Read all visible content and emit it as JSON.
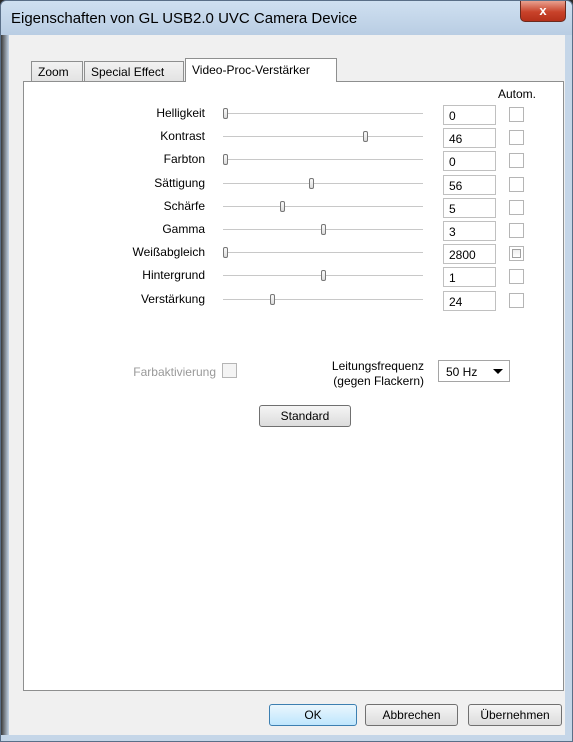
{
  "window": {
    "title": "Eigenschaften von GL USB2.0 UVC Camera Device",
    "close_label": "x"
  },
  "tabs": [
    {
      "label": "Zoom",
      "active": false
    },
    {
      "label": "Special Effect",
      "active": false
    },
    {
      "label": "Video-Proc-Verstärker",
      "active": true
    }
  ],
  "autom_header": "Autom.",
  "sliders": [
    {
      "label": "Helligkeit",
      "value": "0",
      "level": 0.0
    },
    {
      "label": "Kontrast",
      "value": "46",
      "level": 0.72
    },
    {
      "label": "Farbton",
      "value": "0",
      "level": 0.0
    },
    {
      "label": "Sättigung",
      "value": "56",
      "level": 0.44
    },
    {
      "label": "Schärfe",
      "value": "5",
      "level": 0.29
    },
    {
      "label": "Gamma",
      "value": "3",
      "level": 0.5
    },
    {
      "label": "Weißabgleich",
      "value": "2800",
      "level": 0.0
    },
    {
      "label": "Hintergrund",
      "value": "1",
      "level": 0.5
    },
    {
      "label": "Verstärkung",
      "value": "24",
      "level": 0.24
    }
  ],
  "farbaktivierung_label": "Farbaktivierung",
  "leitungsfrequenz_label_1": "Leitungsfrequenz",
  "leitungsfrequenz_label_2": "(gegen Flackern)",
  "frequency_value": "50 Hz",
  "standard_button": "Standard",
  "footer": {
    "ok": "OK",
    "cancel": "Abbrechen",
    "apply": "Übernehmen"
  }
}
